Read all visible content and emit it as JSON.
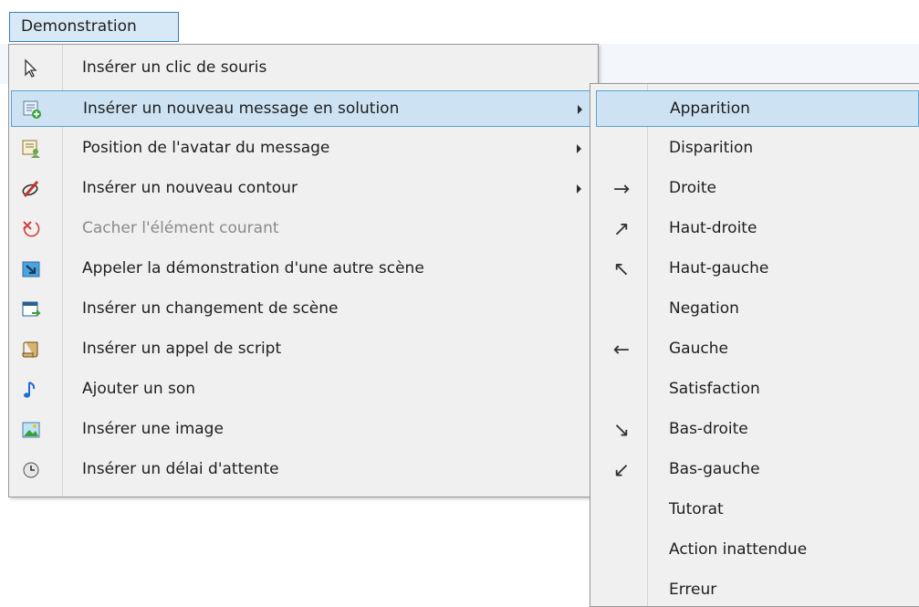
{
  "menubar": {
    "demonstration_label": "Demonstration"
  },
  "main_menu": {
    "items": [
      {
        "label": "Insérer un clic de souris",
        "icon": "mouse-cursor-icon",
        "submenu": false,
        "disabled": false
      },
      {
        "label": "Insérer un nouveau message en solution",
        "icon": "new-message-icon",
        "submenu": true,
        "disabled": false,
        "highlighted": true
      },
      {
        "label": "Position de l'avatar du message",
        "icon": "avatar-position-icon",
        "submenu": true,
        "disabled": false
      },
      {
        "label": "Insérer un nouveau contour",
        "icon": "contour-icon",
        "submenu": true,
        "disabled": false
      },
      {
        "label": "Cacher l'élément courant",
        "icon": "hide-element-icon",
        "submenu": false,
        "disabled": true
      },
      {
        "label": "Appeler la démonstration d'une autre scène",
        "icon": "call-scene-icon",
        "submenu": false,
        "disabled": false
      },
      {
        "label": "Insérer un changement de scène",
        "icon": "scene-change-icon",
        "submenu": false,
        "disabled": false
      },
      {
        "label": "Insérer un appel de script",
        "icon": "script-icon",
        "submenu": false,
        "disabled": false
      },
      {
        "label": "Ajouter un son",
        "icon": "music-note-icon",
        "submenu": false,
        "disabled": false
      },
      {
        "label": "Insérer une image",
        "icon": "image-icon",
        "submenu": false,
        "disabled": false
      },
      {
        "label": "Insérer un délai d'attente",
        "icon": "clock-icon",
        "submenu": false,
        "disabled": false
      }
    ]
  },
  "sub_menu": {
    "items": [
      {
        "label": "Apparition",
        "glyph": "",
        "highlighted": true
      },
      {
        "label": "Disparition",
        "glyph": ""
      },
      {
        "label": "Droite",
        "glyph": "→"
      },
      {
        "label": "Haut-droite",
        "glyph": "↗"
      },
      {
        "label": "Haut-gauche",
        "glyph": "↖"
      },
      {
        "label": "Negation",
        "glyph": ""
      },
      {
        "label": "Gauche",
        "glyph": "←"
      },
      {
        "label": "Satisfaction",
        "glyph": ""
      },
      {
        "label": "Bas-droite",
        "glyph": "↘"
      },
      {
        "label": "Bas-gauche",
        "glyph": "↙"
      },
      {
        "label": "Tutorat",
        "glyph": ""
      },
      {
        "label": "Action inattendue",
        "glyph": ""
      },
      {
        "label": "Erreur",
        "glyph": ""
      }
    ]
  },
  "colors": {
    "highlight_bg": "#cde3f3",
    "highlight_border": "#5da2d4",
    "menu_bg": "#f0f0f0",
    "disabled_text": "#8a8a8a"
  }
}
